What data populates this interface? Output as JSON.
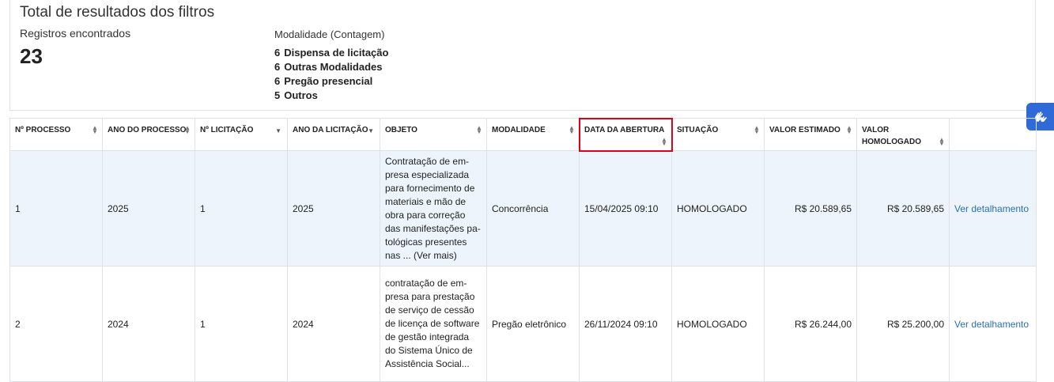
{
  "summary": {
    "title": "Total de resultados dos filtros",
    "registros_label": "Registros encontrados",
    "registros_count": "23",
    "modalidade_label": "Modalidade (Contagem)",
    "modalidades": [
      {
        "count": "6",
        "name": "Dispensa de licitação"
      },
      {
        "count": "6",
        "name": "Outras Modalidades"
      },
      {
        "count": "6",
        "name": "Pregão presencial"
      },
      {
        "count": "5",
        "name": "Outros"
      }
    ]
  },
  "accessibility_button": {
    "icon": "sign-language-hands-icon",
    "color": "#2f6ad6"
  },
  "table": {
    "headers": {
      "processo": "Nº PROCESSO",
      "ano_processo": "ANO DO PROCESSO",
      "licitacao": "Nº LICITAÇÃO",
      "ano_licitacao": "ANO DA LICITAÇÃO",
      "objeto": "OBJETO",
      "modalidade": "MODALIDADE",
      "data_abertura": "DATA DA ABERTURA",
      "situacao": "SITUAÇÃO",
      "valor_estimado": "VALOR ESTIMADO",
      "valor_homologado": "VALOR HOMOLOGADO"
    },
    "rows": [
      {
        "processo": "1",
        "ano_processo": "2025",
        "licitacao": "1",
        "ano_licitacao": "2025",
        "objeto_lines": [
          "Contratação de em-",
          "presa especializada",
          "para fornecimento de",
          "materiais e mão de",
          "obra para correção",
          "das manifestações pa-",
          "tológicas presentes",
          "nas ... (Ver mais)"
        ],
        "modalidade": "Concorrência",
        "data_abertura": "15/04/2025 09:10",
        "situacao": "HOMOLOGADO",
        "valor_estimado": "R$ 20.589,65",
        "valor_homologado": "R$ 20.589,65",
        "link": "Ver detalhamento"
      },
      {
        "processo": "2",
        "ano_processo": "2024",
        "licitacao": "1",
        "ano_licitacao": "2024",
        "objeto_lines": [
          "contratação de em-",
          "presa para prestação",
          "de serviço de cessão",
          "de licença de software",
          "de gestão integrada",
          "do Sistema Único de",
          "Assistência Social..."
        ],
        "modalidade": "Pregão eletrônico",
        "data_abertura": "26/11/2024 09:10",
        "situacao": "HOMOLOGADO",
        "valor_estimado": "R$ 26.244,00",
        "valor_homologado": "R$ 25.200,00",
        "link": "Ver detalhamento"
      }
    ]
  },
  "colors": {
    "link": "#2a6fb5",
    "row_highlight": "#edf4fb",
    "sorted_column_border": "#e0001b"
  }
}
